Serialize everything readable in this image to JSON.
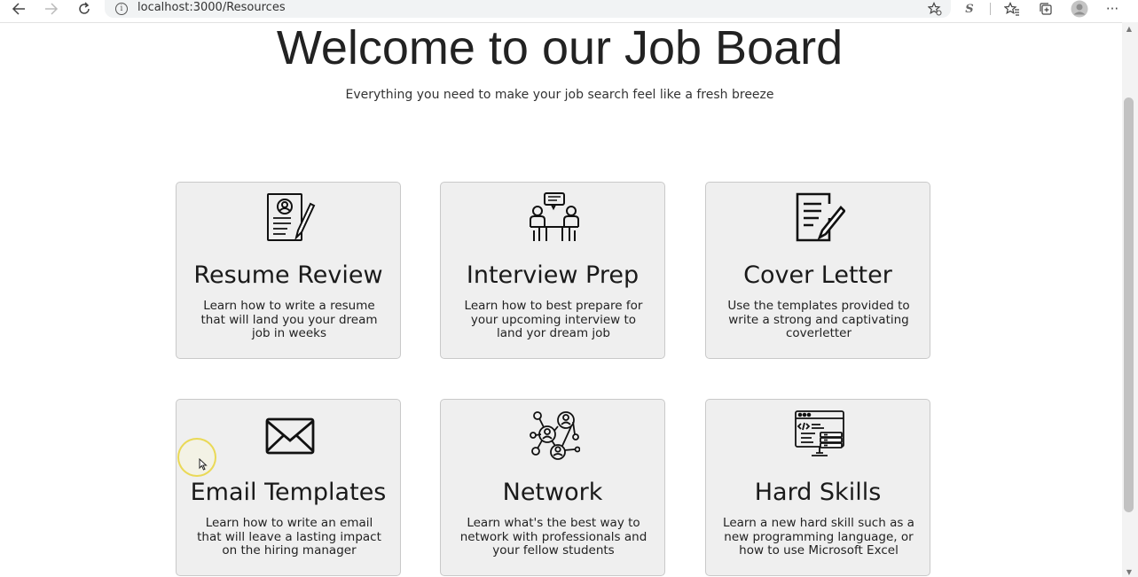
{
  "browser": {
    "url": "localhost:3000/Resources",
    "info_glyph": "i",
    "icons": [
      "back-icon",
      "forward-icon",
      "refresh-icon",
      "info-icon",
      "favorite-add-icon",
      "extension-s-icon",
      "favorites-icon",
      "collections-icon",
      "profile-icon",
      "more-icon"
    ],
    "extension_label": "S",
    "more_label": "···"
  },
  "hero": {
    "title": "Welcome to our Job Board",
    "subtitle": "Everything you need to make your job search feel like a fresh breeze"
  },
  "cards": [
    {
      "title": "Resume Review",
      "description": "Learn how to write a resume that will land you your dream job in weeks",
      "icon": "resume-icon"
    },
    {
      "title": "Interview Prep",
      "description": "Learn how to best prepare for your upcoming interview to land yor dream job",
      "icon": "interview-icon"
    },
    {
      "title": "Cover Letter",
      "description": "Use the templates provided to write a strong and captivating coverletter",
      "icon": "cover-letter-icon"
    },
    {
      "title": "Email Templates",
      "description": "Learn how to write an email that will leave a lasting impact on the hiring manager",
      "icon": "email-icon"
    },
    {
      "title": "Network",
      "description": "Learn what's the best way to network with professionals and your fellow students",
      "icon": "network-icon"
    },
    {
      "title": "Hard Skills",
      "description": "Learn a new hard skill such as a new programming language, or how to use Microsoft Excel",
      "icon": "hard-skills-icon"
    }
  ],
  "colors": {
    "card_background": "#efefef",
    "card_border": "#c9c9c9",
    "cursor_highlight": "#e8d43c"
  }
}
